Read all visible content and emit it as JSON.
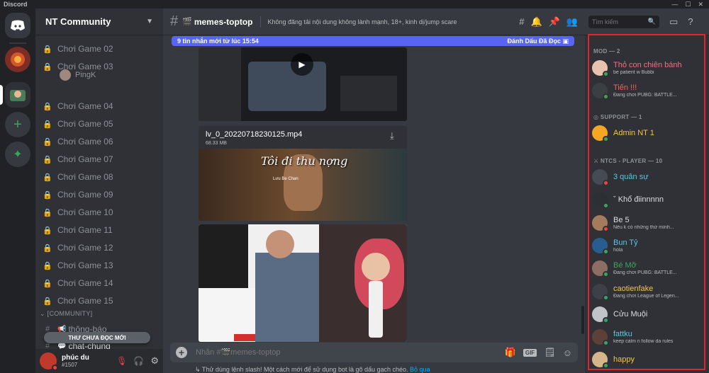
{
  "app": {
    "title": "Discord"
  },
  "colors": {
    "blurple": "#5865f2",
    "online": "#3ba55d",
    "dnd": "#ed4245",
    "idle": "#faa61a",
    "link": "#00aff4",
    "highlight_box": "#e3242b"
  },
  "server": {
    "name": "NT Community"
  },
  "channels": [
    {
      "label": "Chơi Game 02",
      "icon": "lock-icon"
    },
    {
      "label": "Chơi Game 03",
      "icon": "lock-icon"
    },
    {
      "label": "Chơi Game 04",
      "icon": "lock-icon"
    },
    {
      "label": "Chơi Game 05",
      "icon": "lock-icon"
    },
    {
      "label": "Chơi Game 06",
      "icon": "lock-icon"
    },
    {
      "label": "Chơi Game 07",
      "icon": "lock-icon"
    },
    {
      "label": "Chơi Game 08",
      "icon": "lock-icon"
    },
    {
      "label": "Chơi Game 09",
      "icon": "lock-icon"
    },
    {
      "label": "Chơi Game 10",
      "icon": "lock-icon"
    },
    {
      "label": "Chơi Game 11",
      "icon": "lock-icon"
    },
    {
      "label": "Chơi Game 12",
      "icon": "lock-icon"
    },
    {
      "label": "Chơi Game 13",
      "icon": "lock-icon"
    },
    {
      "label": "Chơi Game 14",
      "icon": "lock-icon"
    },
    {
      "label": "Chơi Game 15",
      "icon": "lock-icon"
    }
  ],
  "voice_user": {
    "name": "PingK"
  },
  "category": {
    "label": "[COMMUNITY]"
  },
  "community_channels": [
    {
      "label": "thông-báo"
    },
    {
      "label": "chat-chung"
    }
  ],
  "unread_pill": {
    "label": "THƯ CHƯA ĐỌC MỚI"
  },
  "user": {
    "name": "phúc du",
    "tag": "#1507"
  },
  "channel_header": {
    "name": "memes-toptop",
    "topic": "Không đăng tải nội dung không lành mạnh, 18+, kinh dị/jump scare"
  },
  "new_messages": {
    "text": "9 tin nhắn mới từ lúc 15:54",
    "mark_read": "Đánh Dấu Đã Đọc"
  },
  "attachment": {
    "filename": "lv_0_20220718230125.mp4",
    "size": "68.33 MB",
    "overlay_text": "Tôi đi thu nợng",
    "caption": "Lưu Be Chan"
  },
  "composer": {
    "placeholder": "Nhắn #🎬memes-toptop",
    "gif": "GIF"
  },
  "tip": {
    "text": "Thử dùng lệnh slash! Một cách mới để sử dụng bot là gõ dấu gạch chéo.",
    "link": "Bỏ qua"
  },
  "search": {
    "placeholder": "Tìm kiếm"
  },
  "member_sections": [
    {
      "title": "MOD — 2"
    },
    {
      "title": "SUPPORT — 1"
    },
    {
      "title": "NTCS - PLAYER — 10"
    }
  ],
  "members": [
    {
      "name": "Thỏ con chiên bánh",
      "sub": "be patient w Bubbi",
      "color": "#ff6b81",
      "status": "online",
      "avatar": "#e8c4b0"
    },
    {
      "name": "Tiến !!!",
      "sub": "Đang chơi PUBG: BATTLE...",
      "color": "#ff5c5c",
      "status": "online",
      "avatar": "#3a3f44"
    },
    {
      "name": "Admin NT 1",
      "sub": "",
      "color": "#f5c542",
      "status": "online",
      "avatar": "#f5a623"
    },
    {
      "name": "3 quân sự",
      "sub": "",
      "color": "#57c7e3",
      "status": "dnd",
      "avatar": "#444b55"
    },
    {
      "name": "ˇ Khổ điinnnnn",
      "sub": "",
      "color": "#dcddde",
      "status": "online",
      "avatar": "#2c2f33"
    },
    {
      "name": "Be 5",
      "sub": "Nếu k có những thứ mình...",
      "color": "#dcddde",
      "status": "dnd",
      "avatar": "#a57b5e"
    },
    {
      "name": "Bun Tỷ",
      "sub": "hola",
      "color": "#57c7e3",
      "status": "online",
      "avatar": "#2a5d8f"
    },
    {
      "name": "Bé Mỡ",
      "sub": "Đang chơi PUBG: BATTLE...",
      "color": "#3ba55d",
      "status": "online",
      "avatar": "#8d6e63"
    },
    {
      "name": "caotienfake",
      "sub": "Đang chơi League of Legen...",
      "color": "#f5c542",
      "status": "online",
      "avatar": "#3d4046"
    },
    {
      "name": "Cửu Muội",
      "sub": "",
      "color": "#dcddde",
      "status": "online",
      "avatar": "#c0c4c8"
    },
    {
      "name": "fattku",
      "sub": "keep calm n follow da rules",
      "color": "#57c7e3",
      "status": "online",
      "avatar": "#5d4037"
    },
    {
      "name": "happy",
      "sub": "",
      "color": "#f5c542",
      "status": "online",
      "avatar": "#d7b58a"
    }
  ]
}
